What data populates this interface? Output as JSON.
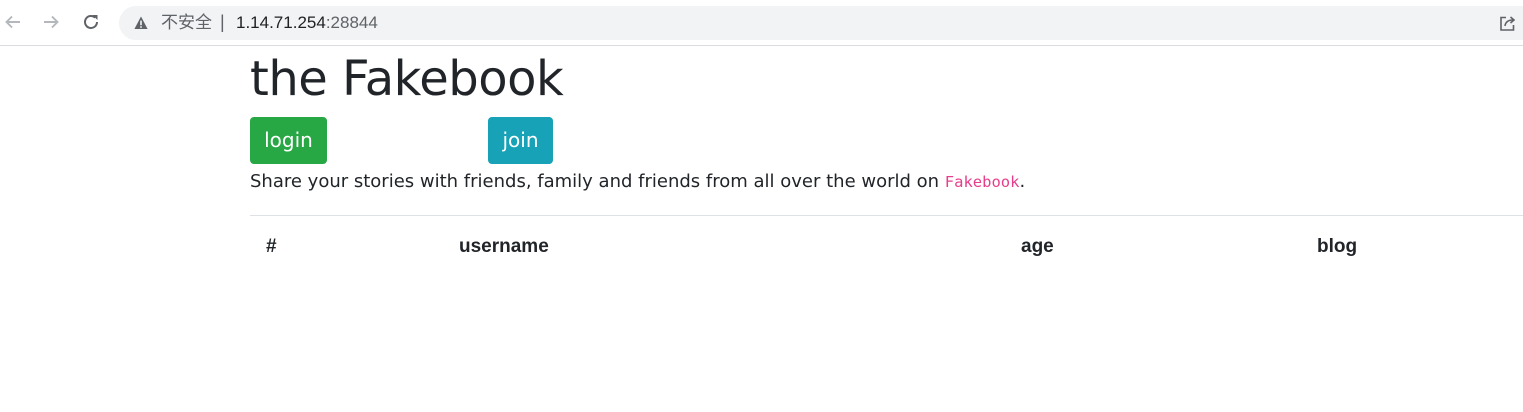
{
  "browser": {
    "security_label": "不安全",
    "separator": "|",
    "url_host": "1.14.71.254",
    "url_port": ":28844"
  },
  "page": {
    "title": "the Fakebook",
    "login_label": "login",
    "join_label": "join",
    "lead_text": "Share your stories with friends, family and friends from all over the world on ",
    "lead_code": "Fakebook",
    "lead_end": "."
  },
  "table": {
    "columns": [
      "#",
      "username",
      "age",
      "blog"
    ],
    "rows": []
  },
  "colors": {
    "login_button": "#28a745",
    "join_button": "#17a2b8",
    "code_text": "#e83e8c"
  }
}
